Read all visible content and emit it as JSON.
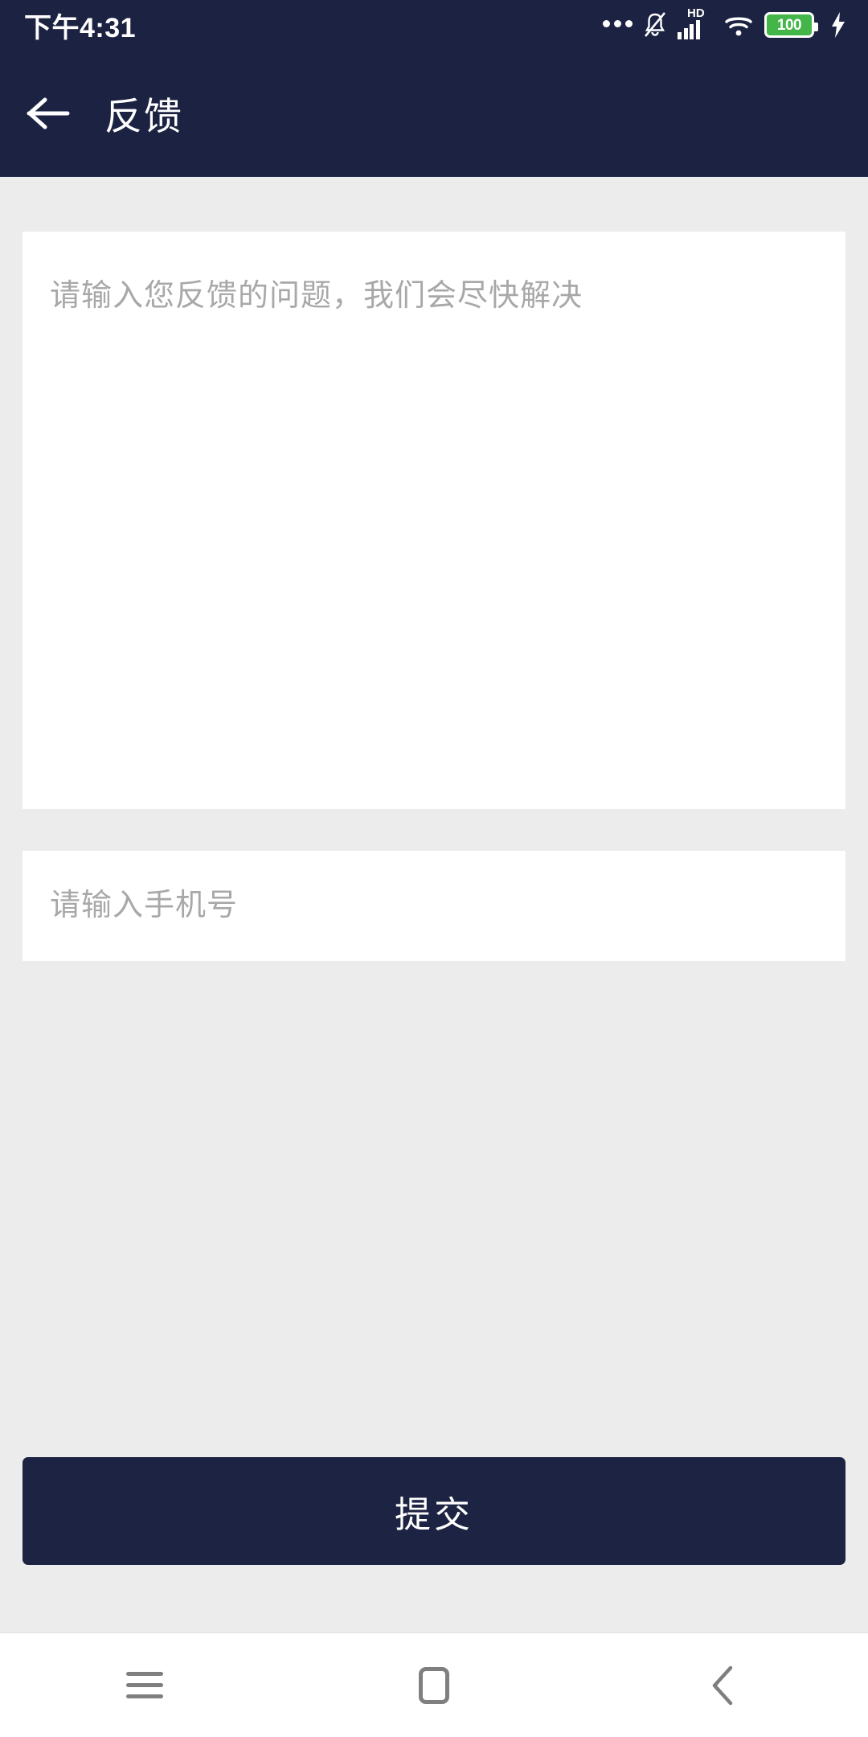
{
  "status_bar": {
    "time": "下午4:31",
    "battery_level": "100",
    "hd_label": "HD",
    "icons": [
      "notification-dots-icon",
      "bell-muted-icon",
      "hd-signal-icon",
      "wifi-icon",
      "battery-icon",
      "charging-bolt-icon"
    ],
    "background_color": "#1c2342",
    "foreground_color": "#ffffff",
    "battery_fill_color": "#43b549"
  },
  "header": {
    "title": "反馈",
    "back_icon": "arrow-left-icon",
    "background_color": "#1c2342",
    "title_color": "#ffffff"
  },
  "form": {
    "feedback": {
      "placeholder": "请输入您反馈的问题，我们会尽快解决",
      "value": "",
      "placeholder_color": "#a8a8a8",
      "background_color": "#ffffff"
    },
    "phone": {
      "placeholder": "请输入手机号",
      "value": "",
      "placeholder_color": "#a8a8a8",
      "background_color": "#ffffff"
    }
  },
  "submit": {
    "label": "提交",
    "background_color": "#1d2342",
    "text_color": "#ffffff"
  },
  "page": {
    "background_color": "#ececec"
  },
  "system_nav": {
    "items": [
      {
        "name": "recents",
        "icon": "menu-lines-icon"
      },
      {
        "name": "home",
        "icon": "square-icon"
      },
      {
        "name": "back",
        "icon": "chevron-left-icon"
      }
    ],
    "background_color": "#ffffff",
    "icon_color": "#7f7f7f"
  }
}
